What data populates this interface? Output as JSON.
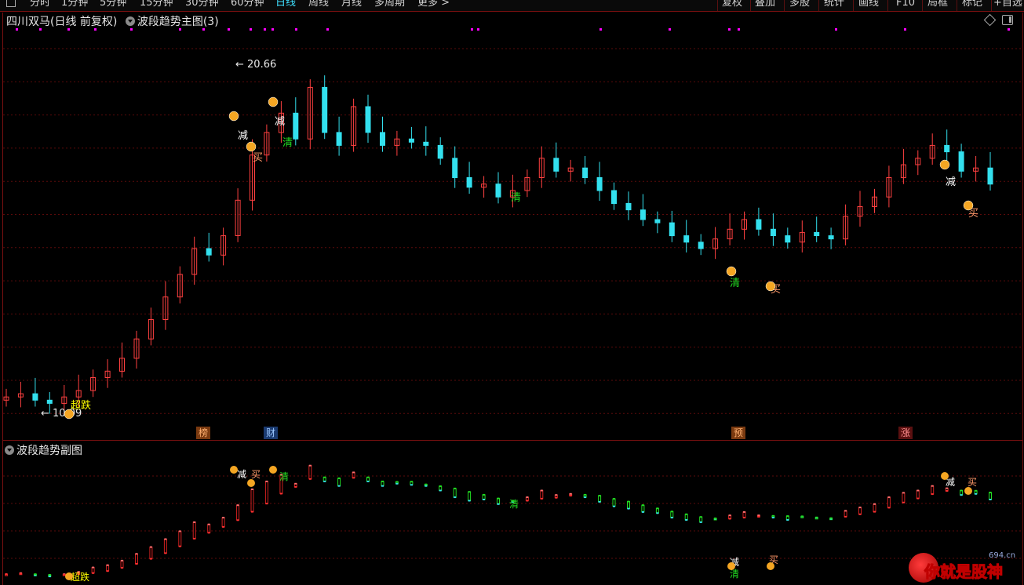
{
  "toolbar": {
    "left_tabs": [
      "分时",
      "1分钟",
      "5分钟",
      "15分钟",
      "30分钟",
      "60分钟",
      "日线",
      "周线",
      "月线",
      "多周期",
      "更多 >"
    ],
    "active_tab": "日线",
    "right_tabs": [
      "复权",
      "叠加",
      "多股",
      "统计",
      "画线",
      "F10",
      "局框",
      "标记",
      "+自选"
    ]
  },
  "main_chart": {
    "stock_name": "四川双马",
    "stock_mode": "(日线 前复权)",
    "indicator": "波段趋势主图",
    "indicator_param": "(3)",
    "high_label": "20.66",
    "low_label": "10.09"
  },
  "sub_chart": {
    "title": "波段趋势副图"
  },
  "events": [
    {
      "label": "榜",
      "color": "#d2691e"
    },
    {
      "label": "财",
      "color": "#2a6ab8"
    },
    {
      "label": "预",
      "color": "#d2691e"
    },
    {
      "label": "涨",
      "color": "#a01818"
    }
  ],
  "signals": {
    "reduce": "减",
    "buy": "买",
    "clear": "清",
    "super_fall": "超跌"
  },
  "watermark": {
    "text": "你就是股神",
    "site": "694.cn"
  },
  "colors": {
    "up": "#ff4040",
    "down": "#33e0ee",
    "clear": "#22dd22",
    "grid": "#5a0a0a",
    "magenta": "#ff00ff"
  },
  "chart_data": [
    {
      "type": "candlestick",
      "title": "四川双马(日线 前复权)",
      "annotations": {
        "max": 20.66,
        "min": 10.09
      },
      "close_estimates": [
        10.4,
        10.5,
        10.3,
        10.2,
        10.4,
        10.6,
        11.0,
        11.2,
        11.6,
        12.2,
        12.8,
        13.5,
        14.2,
        15.0,
        14.8,
        15.4,
        16.5,
        17.9,
        18.6,
        19.2,
        18.4,
        20.0,
        18.6,
        18.2,
        19.4,
        18.6,
        18.2,
        18.4,
        18.3,
        18.2,
        17.8,
        17.2,
        16.9,
        17.0,
        16.6,
        16.8,
        17.2,
        17.8,
        17.4,
        17.5,
        17.2,
        16.8,
        16.4,
        16.2,
        15.9,
        15.8,
        15.4,
        15.2,
        15.0,
        15.3,
        15.6,
        15.9,
        15.6,
        15.4,
        15.2,
        15.5,
        15.4,
        15.3,
        16.0,
        16.3,
        16.6,
        17.2,
        17.6,
        17.8,
        18.2,
        18.0,
        17.4,
        17.5,
        17.0
      ]
    },
    {
      "type": "line",
      "title": "波段趋势副图",
      "series": [
        {
          "name": "",
          "color": "#33e0ee"
        },
        {
          "name": "",
          "color": "#ff4040"
        }
      ]
    }
  ]
}
